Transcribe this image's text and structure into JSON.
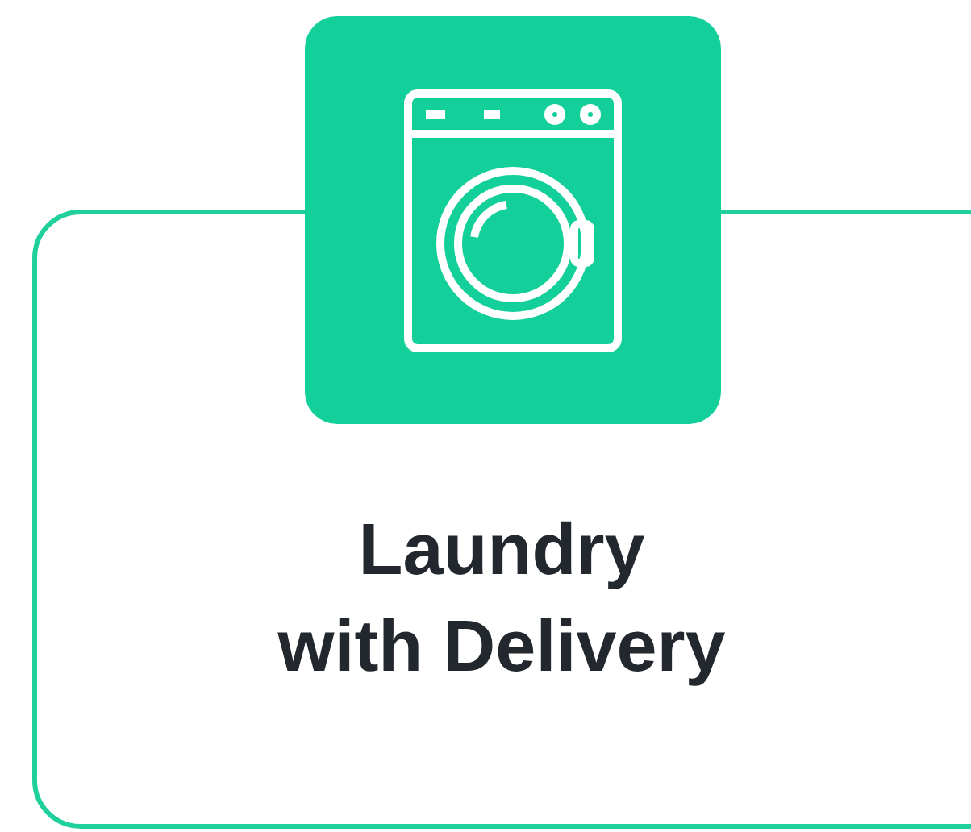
{
  "card": {
    "title": "Laundry\nwith Delivery"
  }
}
